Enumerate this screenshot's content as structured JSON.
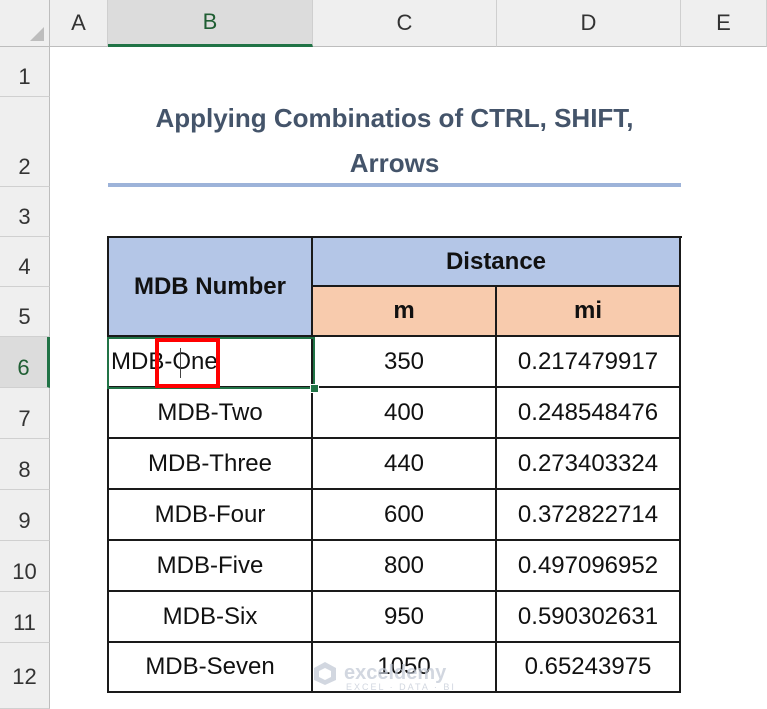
{
  "sheet": {
    "columns": [
      "A",
      "B",
      "C",
      "D",
      "E"
    ],
    "rows": [
      "1",
      "2",
      "3",
      "4",
      "5",
      "6",
      "7",
      "8",
      "9",
      "10",
      "11",
      "12"
    ],
    "selected_column": "B",
    "selected_row": "6"
  },
  "title": {
    "line1": "Applying Combinatios of CTRL, SHIFT,",
    "line2": "Arrows"
  },
  "table": {
    "header_number": "MDB Number",
    "header_distance": "Distance",
    "header_m": "m",
    "header_mi": "mi",
    "rows": [
      {
        "name": "MDB-One",
        "m": "350",
        "mi": "0.217479917"
      },
      {
        "name": "MDB-Two",
        "m": "400",
        "mi": "0.248548476"
      },
      {
        "name": "MDB-Three",
        "m": "440",
        "mi": "0.273403324"
      },
      {
        "name": "MDB-Four",
        "m": "600",
        "mi": "0.372822714"
      },
      {
        "name": "MDB-Five",
        "m": "800",
        "mi": "0.497096952"
      },
      {
        "name": "MDB-Six",
        "m": "950",
        "mi": "0.590302631"
      },
      {
        "name": "MDB-Seven",
        "m": "1050",
        "mi": "0.65243975"
      }
    ]
  },
  "watermark": {
    "name": "exceldemy",
    "tagline": "EXCEL · DATA · BI"
  },
  "colors": {
    "header_blue": "#b4c6e7",
    "header_orange": "#f8cbad",
    "selection_green": "#217346",
    "highlight_red": "#ff0000"
  }
}
